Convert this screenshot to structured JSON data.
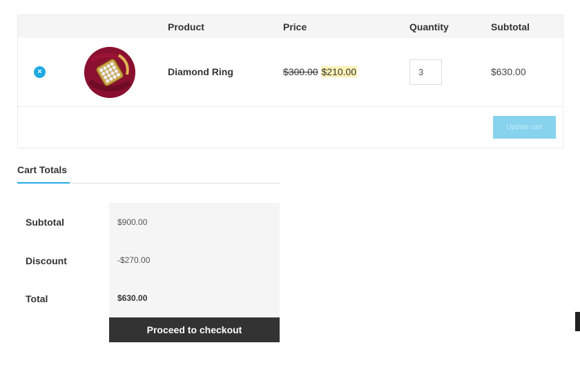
{
  "cart": {
    "columns": {
      "product": "Product",
      "price": "Price",
      "quantity": "Quantity",
      "subtotal": "Subtotal"
    },
    "items": [
      {
        "remove_icon": "×",
        "name": "Diamond Ring",
        "price_original": "$300.00",
        "price_sale": "$210.00",
        "quantity": "3",
        "subtotal": "$630.00",
        "image": "diamond-ring-icon"
      }
    ],
    "update_label": "Update cart"
  },
  "totals": {
    "title": "Cart Totals",
    "rows": [
      {
        "label": "Subtotal",
        "value": "$900.00"
      },
      {
        "label": "Discount",
        "value": "-$270.00"
      },
      {
        "label": "Total",
        "value": "$630.00"
      }
    ],
    "checkout_label": "Proceed to checkout"
  },
  "colors": {
    "accent": "#1fa9e1",
    "checkout_bg": "#333333",
    "sale_highlight": "#fdf2b6",
    "update_button": "#87d3ee"
  }
}
